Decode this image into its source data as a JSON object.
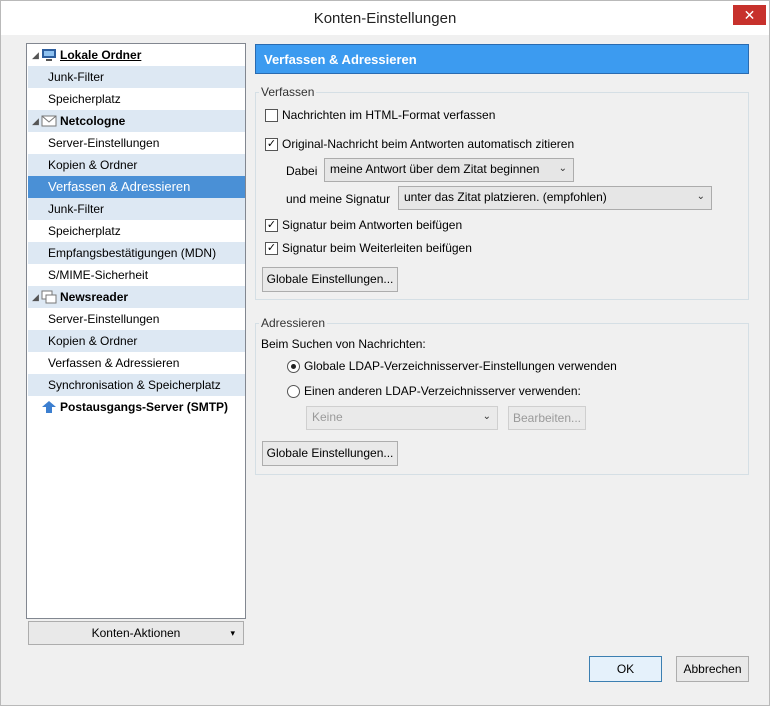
{
  "window": {
    "title": "Konten-Einstellungen",
    "close_label": "✕"
  },
  "tree": {
    "accounts": [
      {
        "name": "Lokale Ordner",
        "items": [
          "Junk-Filter",
          "Speicherplatz"
        ]
      },
      {
        "name": "Netcologne",
        "items": [
          "Server-Einstellungen",
          "Kopien & Ordner",
          "Verfassen & Adressieren",
          "Junk-Filter",
          "Speicherplatz",
          "Empfangsbestätigungen (MDN)",
          "S/MIME-Sicherheit"
        ]
      },
      {
        "name": "Newsreader",
        "items": [
          "Server-Einstellungen",
          "Kopien & Ordner",
          "Verfassen & Adressieren",
          "Synchronisation & Speicherplatz"
        ]
      },
      {
        "name": "Postausgangs-Server (SMTP)",
        "items": []
      }
    ],
    "selected": "Verfassen & Adressieren",
    "accounts_button": "Konten-Aktionen",
    "dropdown_glyph": "▾"
  },
  "panel": {
    "header": "Verfassen & Adressieren",
    "compose": {
      "title": "Verfassen",
      "html_format": "Nachrichten im HTML-Format verfassen",
      "html_checked": false,
      "quote_original": "Original-Nachricht beim Antworten automatisch zitieren",
      "quote_checked": true,
      "then_label": "Dabei",
      "then_value": "meine Antwort über dem Zitat beginnen",
      "signature_label": "und meine Signatur",
      "signature_value": "unter das Zitat platzieren. (empfohlen)",
      "sig_reply": "Signatur beim Antworten beifügen",
      "sig_reply_checked": true,
      "sig_forward": "Signatur beim Weiterleiten beifügen",
      "sig_forward_checked": true,
      "global_button": "Globale Einstellungen..."
    },
    "addressing": {
      "title": "Adressieren",
      "lookup_label": "Beim Suchen von Nachrichten:",
      "global_ldap": "Globale LDAP-Verzeichnisserver-Einstellungen verwenden",
      "other_ldap": "Einen anderen LDAP-Verzeichnisserver verwenden:",
      "selected_option": "global",
      "server_value": "Keine",
      "edit_button": "Bearbeiten...",
      "global_button": "Globale Einstellungen..."
    }
  },
  "footer": {
    "ok": "OK",
    "cancel": "Abbrechen"
  },
  "icons": {
    "checkmark": "✓",
    "chevron": "⌄",
    "tree_twisty": "◢"
  },
  "colors": {
    "accent": "#3c9bf0",
    "selection": "#4a90d6",
    "alt_row": "#dde8f3",
    "close": "#c7312c"
  }
}
